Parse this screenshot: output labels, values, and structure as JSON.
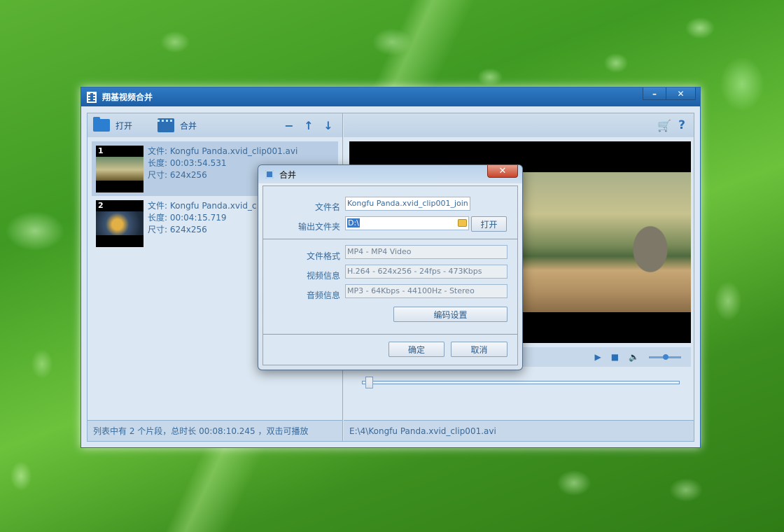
{
  "window": {
    "title": "翔基视频合并",
    "minimize_label": "–",
    "close_label": "✕"
  },
  "toolbar": {
    "open_label": "打开",
    "merge_label": "合并",
    "remove_icon": "−",
    "up_icon": "↑",
    "down_icon": "↓"
  },
  "clips": [
    {
      "index": "1",
      "file": "文件: Kongfu Panda.xvid_clip001.avi",
      "length": "长度: 00:03:54.531",
      "size": "尺寸: 624x256"
    },
    {
      "index": "2",
      "file": "文件: Kongfu Panda.xvid_c",
      "length": "长度: 00:04:15.719",
      "size": "尺寸: 624x256"
    }
  ],
  "status": {
    "left": "列表中有 2 个片段，总时长 00:08:10.245 ，双击可播放",
    "right": "E:\\4\\Kongfu Panda.xvid_clip001.avi"
  },
  "right_toolbar": {
    "cart_icon": "🛒",
    "help_icon": "?"
  },
  "player": {
    "play_icon": "▶",
    "stop_icon": "■",
    "volume_icon": "🔈",
    "volume_level": 0.45,
    "seek_position": 0.02
  },
  "dialog": {
    "title": "合并",
    "close_label": "✕",
    "filename_label": "文件名",
    "filename_value": "Kongfu Panda.xvid_clip001_join",
    "output_folder_label": "输出文件夹",
    "output_folder_value": "D:\\",
    "open_button": "打开",
    "format_label": "文件格式",
    "format_value": "MP4 - MP4 Video",
    "video_label": "视频信息",
    "video_value": "H.264 - 624x256 - 24fps - 473Kbps",
    "audio_label": "音频信息",
    "audio_value": "MP3 - 64Kbps - 44100Hz - Stereo",
    "encode_settings_button": "编码设置",
    "ok_button": "确定",
    "cancel_button": "取消"
  }
}
